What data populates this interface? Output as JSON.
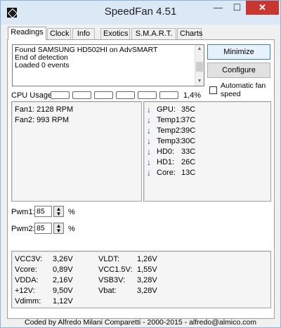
{
  "window": {
    "title": "SpeedFan 4.51",
    "controls": {
      "minimize": "—",
      "maximize": "☐",
      "close": "✕"
    }
  },
  "tabs": [
    "Readings",
    "Clock",
    "Info",
    "Exotics",
    "S.M.A.R.T.",
    "Charts"
  ],
  "log": [
    "Found SAMSUNG HD502HI on AdvSMART",
    "End of detection",
    "Loaded 0 events"
  ],
  "buttons": {
    "minimize": "Minimize",
    "configure": "Configure"
  },
  "auto_fan": {
    "label_line1": "Automatic fan",
    "label_line2": "speed",
    "checked": false
  },
  "cpu": {
    "label": "CPU Usage",
    "percent": "1,4%",
    "segments": 6
  },
  "fans": [
    "Fan1: 2128 RPM",
    "Fan2: 993 RPM"
  ],
  "temps": [
    {
      "name": "GPU:",
      "value": "35C"
    },
    {
      "name": "Temp1:",
      "value": "37C"
    },
    {
      "name": "Temp2:",
      "value": "39C"
    },
    {
      "name": "Temp3:",
      "value": "30C"
    },
    {
      "name": "HD0:",
      "value": "33C"
    },
    {
      "name": "HD1:",
      "value": "26C"
    },
    {
      "name": "Core:",
      "value": "13C"
    }
  ],
  "pwm": [
    {
      "label": "Pwm1:",
      "value": "85",
      "unit": "%"
    },
    {
      "label": "Pwm2:",
      "value": "85",
      "unit": "%"
    }
  ],
  "voltages_left": [
    {
      "name": "VCC3V:",
      "value": "3,26V"
    },
    {
      "name": "Vcore:",
      "value": "0,89V"
    },
    {
      "name": "VDDA:",
      "value": "2,16V"
    },
    {
      "name": "+12V:",
      "value": "9,50V"
    },
    {
      "name": "Vdimm:",
      "value": "1,12V"
    }
  ],
  "voltages_right": [
    {
      "name": "VLDT:",
      "value": "1,26V"
    },
    {
      "name": "VCC1.5V:",
      "value": "1,55V"
    },
    {
      "name": "VSB3V:",
      "value": "3,28V"
    },
    {
      "name": "Vbat:",
      "value": "3,28V"
    }
  ],
  "status": "Coded by Alfredo Milani Comparetti - 2000-2015 - alfredo@almico.com"
}
